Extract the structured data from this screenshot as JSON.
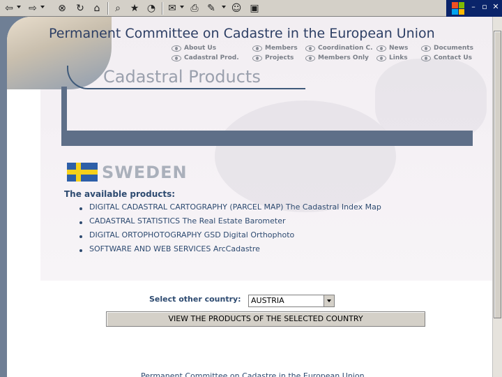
{
  "window": {
    "minimize": "–",
    "restore": "▫",
    "close": "✕"
  },
  "toolbar": {
    "icons": [
      "back-arrow-icon",
      "forward-arrow-icon",
      "stop-icon",
      "refresh-icon",
      "home-icon",
      "search-icon",
      "favorites-icon",
      "history-icon",
      "mail-icon",
      "print-icon",
      "edit-icon",
      "messenger-icon",
      "discuss-icon"
    ]
  },
  "site": {
    "title": "Permanent Committee on Cadastre in the European Union",
    "nav": [
      {
        "label": "About Us"
      },
      {
        "label": "Cadastral Prod."
      },
      {
        "label": "Members"
      },
      {
        "label": "Projects"
      },
      {
        "label": "Coordination C."
      },
      {
        "label": "Members Only"
      },
      {
        "label": "News"
      },
      {
        "label": "Links"
      },
      {
        "label": "Documents"
      },
      {
        "label": "Contact Us"
      }
    ]
  },
  "section": {
    "title": "Cadastral Products"
  },
  "country": {
    "name": "SWEDEN",
    "flag_colors": {
      "blue": "#2d5fa8",
      "yellow": "#f6d01a"
    },
    "available_label": "The available products:",
    "products": [
      "DIGITAL CADASTRAL CARTOGRAPHY (PARCEL MAP) The Cadastral Index Map",
      "CADASTRAL STATISTICS The Real Estate Barometer",
      "DIGITAL ORTOPHOTOGRAPHY GSD Digital Orthophoto",
      "SOFTWARE AND WEB SERVICES ArcCadastre"
    ]
  },
  "selector": {
    "label": "Select other country:",
    "selected": "AUSTRIA",
    "button": "VIEW THE PRODUCTS OF THE SELECTED COUNTRY"
  },
  "footer": {
    "text": "Permanent Committee on Cadastre in the European Union"
  },
  "colors": {
    "accent": "#2d4a70",
    "slate": "#5e6f88",
    "muted": "#9aa0ad"
  }
}
